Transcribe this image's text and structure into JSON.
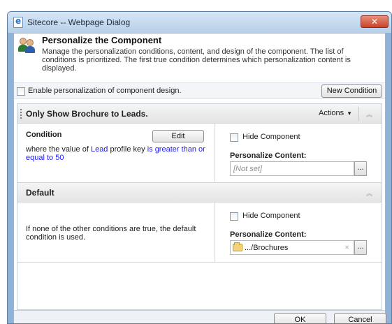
{
  "window": {
    "title": "Sitecore -- Webpage Dialog",
    "close_label": "✕"
  },
  "header": {
    "title": "Personalize the Component",
    "description": "Manage the personalization conditions, content, and design of the component. The list of conditions is prioritized. The first true condition determines which personalization content is displayed."
  },
  "toolbar": {
    "enable_label": "Enable personalization of component design.",
    "new_condition_label": "New Condition"
  },
  "rules": [
    {
      "name": "Only Show Brochure to Leads.",
      "actions_label": "Actions",
      "condition_title": "Condition",
      "edit_label": "Edit",
      "condition_text": {
        "prefix": "where the value of ",
        "field": "Lead",
        "middle": " profile key ",
        "operator": "is greater than or equal to",
        "space": " ",
        "value": "50"
      },
      "hide_component_label": "Hide Component",
      "personalize_content_label": "Personalize Content:",
      "content_placeholder": "[Not set]",
      "browse_label": "..."
    },
    {
      "name": "Default",
      "description": "If none of the other conditions are true, the default condition is used.",
      "hide_component_label": "Hide Component",
      "personalize_content_label": "Personalize Content:",
      "content_value": ".../Brochures",
      "clear_label": "×",
      "browse_label": "..."
    }
  ],
  "footer": {
    "ok_label": "OK",
    "cancel_label": "Cancel"
  }
}
